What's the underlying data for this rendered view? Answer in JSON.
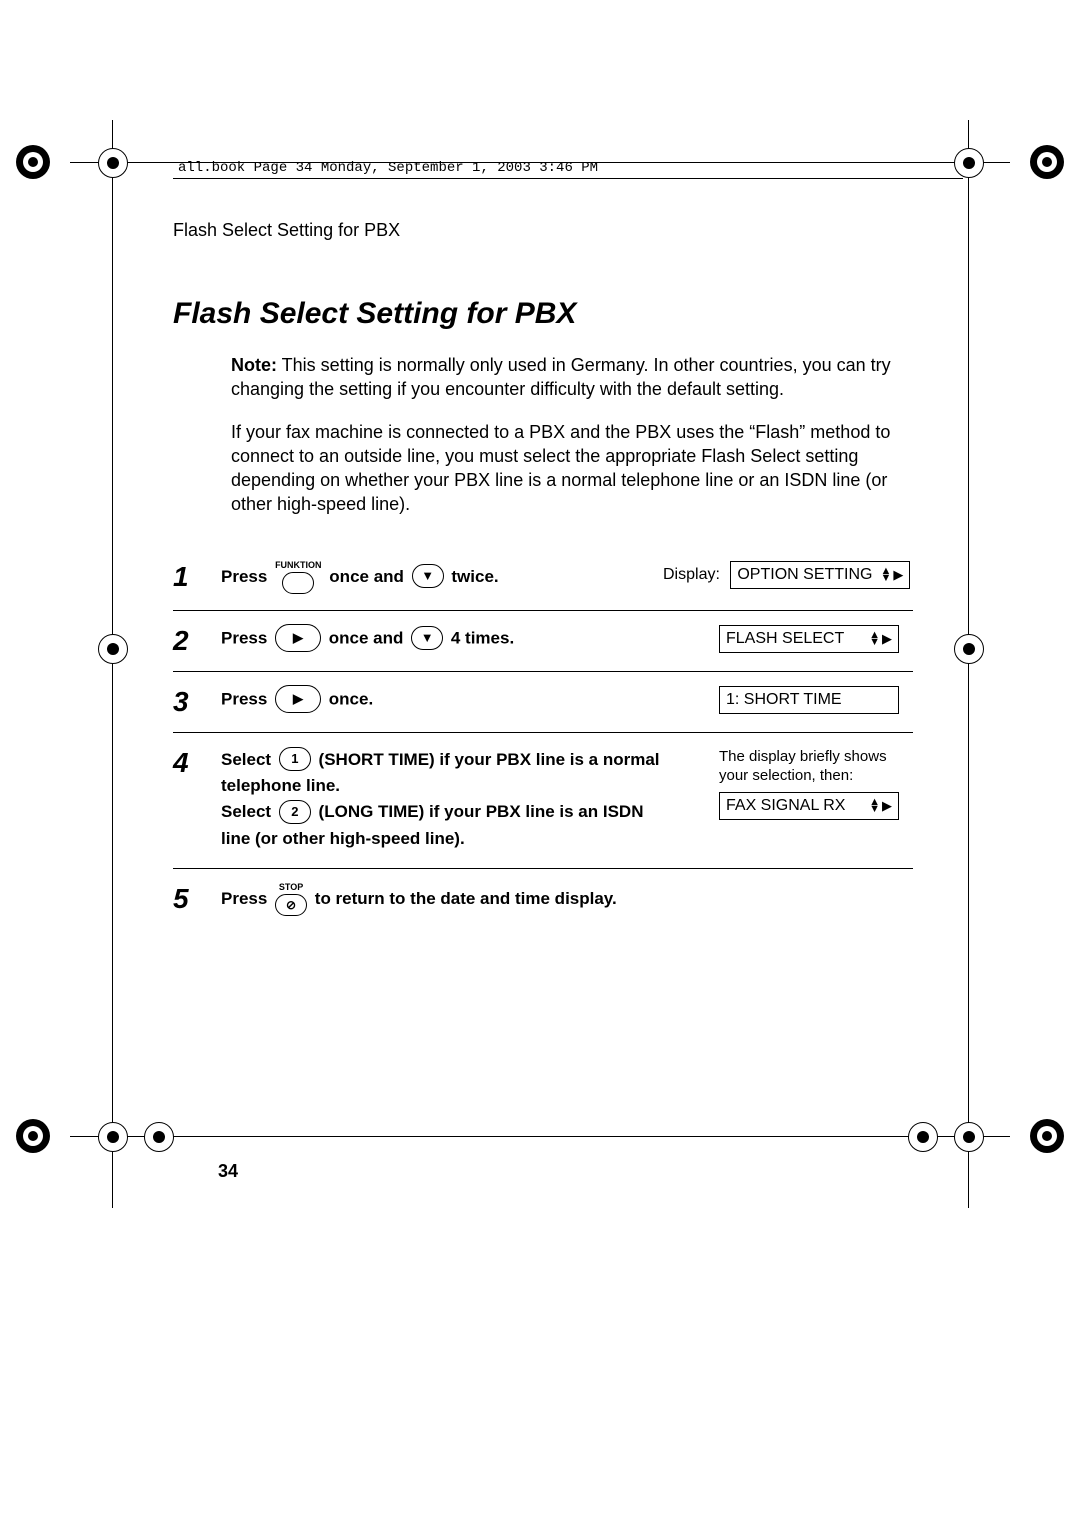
{
  "header_runline": "all.book  Page 34  Monday, September 1, 2003  3:46 PM",
  "running_head": "Flash Select Setting for PBX",
  "title": "Flash Select Setting for PBX",
  "note_label": "Note:",
  "note_text": " This setting is normally only used in Germany. In other countries, you can try changing the setting if you encounter difficulty with the default setting.",
  "para2": "If your fax machine is connected to a PBX and the PBX uses the “Flash” method to connect to an outside line, you must select the appropriate Flash Select setting depending on whether your PBX line is a normal telephone line or an ISDN line (or other high-speed line).",
  "display_label": "Display:",
  "steps": {
    "s1": {
      "num": "1",
      "press": "Press",
      "funktion": "FUNKTION",
      "mid": " once and ",
      "end": " twice.",
      "lcd": "OPTION SETTING"
    },
    "s2": {
      "num": "2",
      "press": "Press ",
      "mid": " once and ",
      "end": " 4 times.",
      "lcd": "FLASH SELECT"
    },
    "s3": {
      "num": "3",
      "press": "Press ",
      "end": " once.",
      "lcd": "1: SHORT TIME"
    },
    "s4": {
      "num": "4",
      "sel": "Select ",
      "k1": "1",
      "t1": " (SHORT TIME) if your PBX line is a normal telephone line.",
      "k2": "2",
      "t2": " (LONG TIME) if your PBX line is an ISDN line (or other high-speed line).",
      "right_note": "The display briefly shows your selection, then:",
      "lcd": "FAX SIGNAL RX"
    },
    "s5": {
      "num": "5",
      "press": "Press ",
      "stop": "STOP",
      "end": " to return to the date and time display."
    }
  },
  "page_number": "34"
}
